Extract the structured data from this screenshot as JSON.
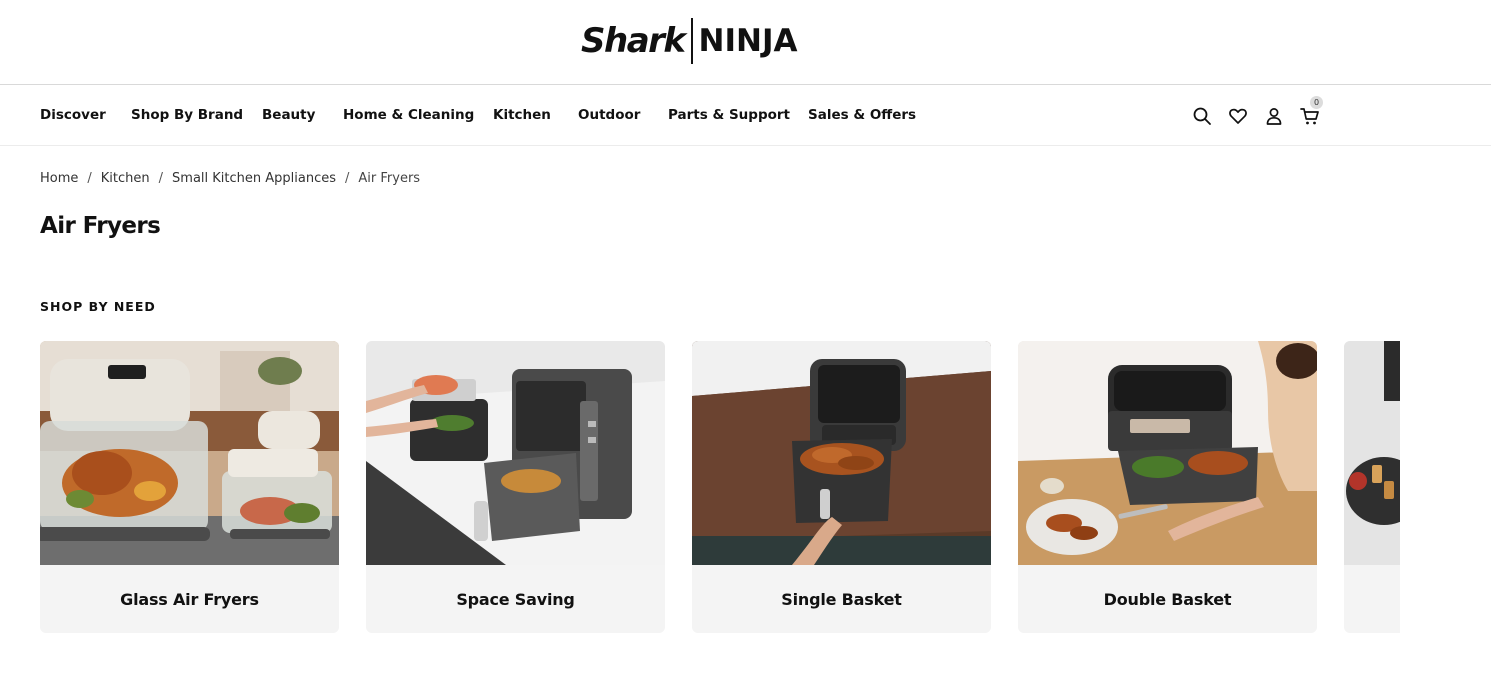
{
  "brand": {
    "shark": "Shark",
    "ninja": "NINJA"
  },
  "nav": {
    "items": [
      {
        "label": "Discover"
      },
      {
        "label": "Shop By Brand"
      },
      {
        "label": "Beauty"
      },
      {
        "label": "Home & Cleaning"
      },
      {
        "label": "Kitchen"
      },
      {
        "label": "Outdoor"
      },
      {
        "label": "Parts & Support"
      },
      {
        "label": "Sales & Offers"
      }
    ],
    "icons": [
      "search-icon",
      "heart-icon",
      "account-icon",
      "cart-icon"
    ],
    "cart_count": "0"
  },
  "breadcrumb": {
    "items": [
      "Home",
      "Kitchen",
      "Small Kitchen Appliances",
      "Air Fryers"
    ],
    "separator": "/"
  },
  "page": {
    "title": "Air Fryers",
    "section_label": "SHOP BY NEED"
  },
  "cards": [
    {
      "label": "Glass Air Fryers"
    },
    {
      "label": "Space Saving"
    },
    {
      "label": "Single Basket"
    },
    {
      "label": "Double Basket"
    }
  ],
  "colors": {
    "text": "#111111",
    "card_bg": "#f4f4f4",
    "divider": "#d9d9d9"
  }
}
